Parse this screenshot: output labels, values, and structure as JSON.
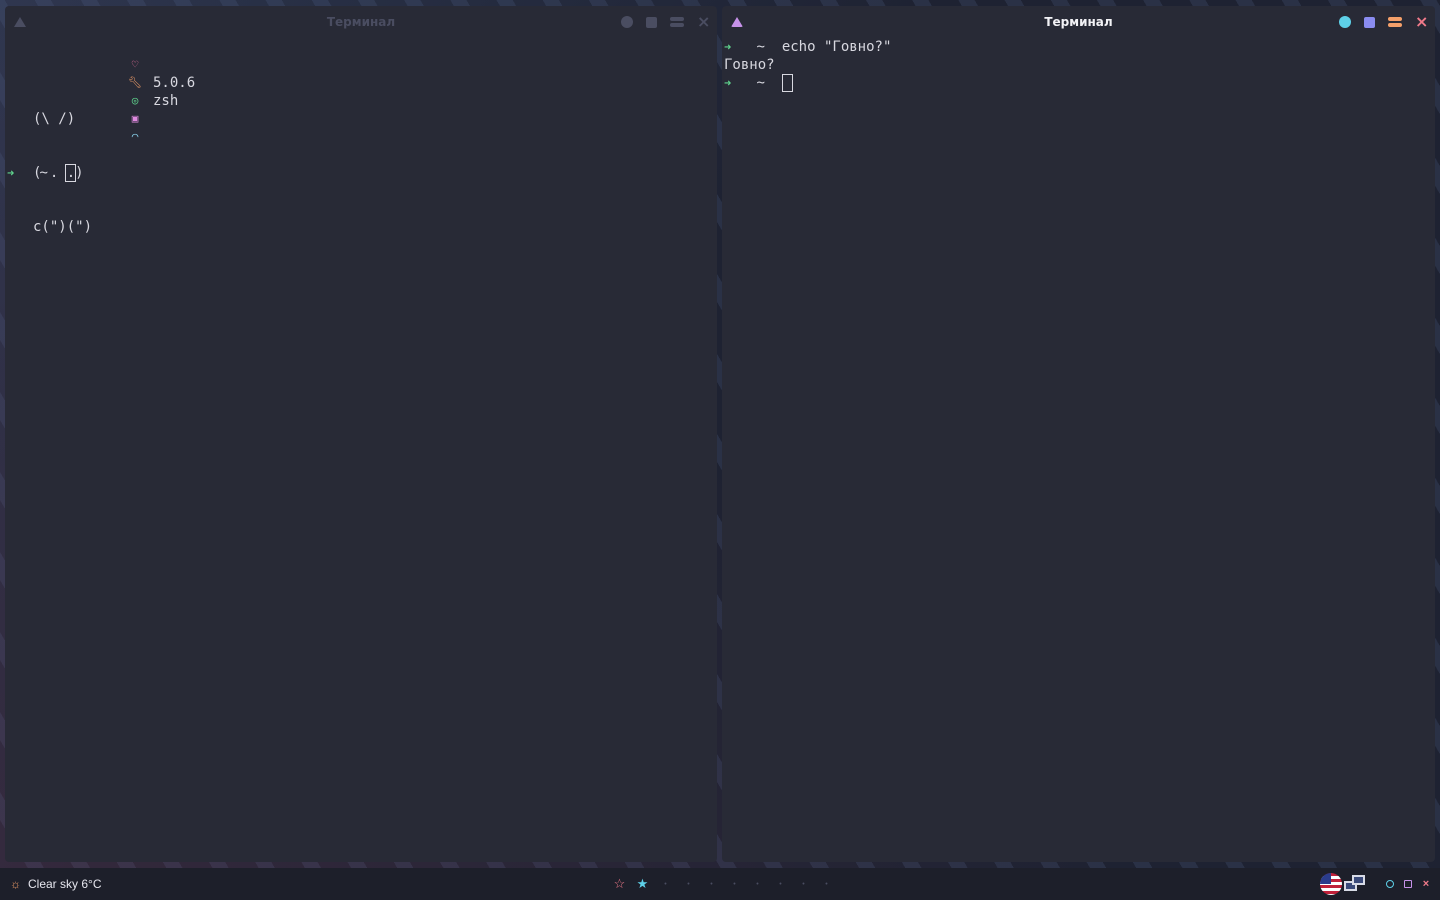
{
  "left_window": {
    "title": "Терминал",
    "fetch": {
      "ascii": [
        "(\\ /)",
        "( . .)",
        "c(\")(\")"
      ],
      "info": [
        {
          "icon": "heart-icon",
          "text": ""
        },
        {
          "icon": "wrench-icon",
          "text": "5.0.6"
        },
        {
          "icon": "shell-icon",
          "text": "zsh"
        },
        {
          "icon": "image-icon",
          "text": ""
        },
        {
          "icon": "wifi-icon",
          "text": ""
        }
      ]
    },
    "prompt": {
      "arrow": "➜",
      "dir": "~"
    }
  },
  "right_window": {
    "title": "Терминал",
    "lines": {
      "cmd_arrow": "➜",
      "cmd_dir": "~",
      "command": "echo \"Говно?\"",
      "output": "Говно?",
      "prompt_arrow": "➜",
      "prompt_dir": "~"
    }
  },
  "bottombar": {
    "weather": "Clear sky 6°C",
    "workspaces": [
      "☆",
      "★",
      "•",
      "•",
      "•",
      "•",
      "•",
      "•",
      "•",
      "•"
    ],
    "tray": {
      "keyboard_layout": "us-flag-icon",
      "network": "network-icon"
    }
  },
  "colors": {
    "terminal_bg": "#282a36",
    "accent_cyan": "#5ed0e8",
    "accent_purple": "#c792ea",
    "accent_orange": "#f5a06a",
    "accent_red": "#f07a8a",
    "prompt_green": "#5fd38d"
  }
}
